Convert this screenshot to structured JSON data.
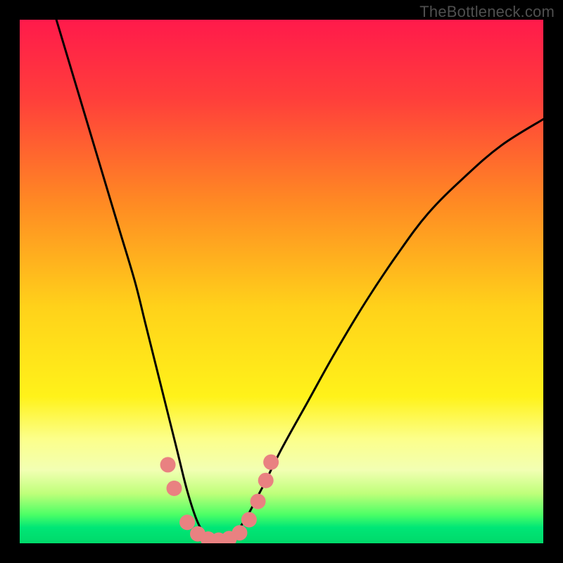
{
  "watermark": "TheBottleneck.com",
  "chart_data": {
    "type": "line",
    "title": "",
    "xlabel": "",
    "ylabel": "",
    "xlim": [
      0,
      100
    ],
    "ylim": [
      0,
      100
    ],
    "grid": false,
    "legend": false,
    "background_gradient": {
      "stops": [
        {
          "offset": 0.0,
          "color": "#ff1a4b"
        },
        {
          "offset": 0.15,
          "color": "#ff3e3b"
        },
        {
          "offset": 0.35,
          "color": "#ff8a23"
        },
        {
          "offset": 0.55,
          "color": "#ffd21a"
        },
        {
          "offset": 0.72,
          "color": "#fff21a"
        },
        {
          "offset": 0.8,
          "color": "#fcff8a"
        },
        {
          "offset": 0.86,
          "color": "#f2ffb3"
        },
        {
          "offset": 0.905,
          "color": "#bfff7a"
        },
        {
          "offset": 0.945,
          "color": "#4dff66"
        },
        {
          "offset": 0.97,
          "color": "#00e676"
        },
        {
          "offset": 1.0,
          "color": "#00d96a"
        }
      ]
    },
    "series": [
      {
        "name": "bottleneck-curve",
        "stroke": "#000000",
        "x": [
          7,
          10,
          13,
          16,
          19,
          22,
          24,
          26,
          28,
          30,
          32,
          34,
          36,
          38,
          42,
          46,
          50,
          55,
          60,
          66,
          72,
          78,
          85,
          92,
          100
        ],
        "y": [
          100,
          90,
          80,
          70,
          60,
          50,
          42,
          34,
          26,
          18,
          10,
          4,
          1,
          0,
          3,
          10,
          18,
          27,
          36,
          46,
          55,
          63,
          70,
          76,
          81
        ]
      }
    ],
    "markers": {
      "name": "highlight-dots",
      "color": "#e98181",
      "points": [
        {
          "x": 28.3,
          "y": 15.0
        },
        {
          "x": 29.5,
          "y": 10.5
        },
        {
          "x": 32.0,
          "y": 4.0
        },
        {
          "x": 34.0,
          "y": 1.8
        },
        {
          "x": 36.0,
          "y": 0.8
        },
        {
          "x": 38.0,
          "y": 0.6
        },
        {
          "x": 40.0,
          "y": 0.9
        },
        {
          "x": 42.0,
          "y": 2.0
        },
        {
          "x": 43.8,
          "y": 4.5
        },
        {
          "x": 45.5,
          "y": 8.0
        },
        {
          "x": 47.0,
          "y": 12.0
        },
        {
          "x": 48.0,
          "y": 15.5
        }
      ]
    }
  }
}
